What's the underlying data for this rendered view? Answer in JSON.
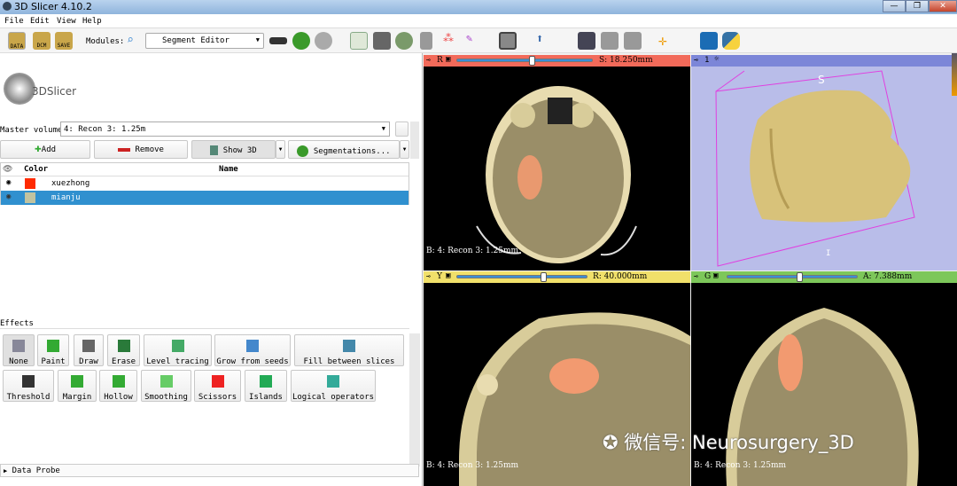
{
  "window": {
    "title": "3D Slicer 4.10.2",
    "controls": [
      "—",
      "❐",
      "✕"
    ]
  },
  "menu": [
    "File",
    "Edit",
    "View",
    "Help"
  ],
  "toolbar": {
    "data": "DATA",
    "dcm": "DCM",
    "save": "SAVE",
    "modules_label": "Modules:",
    "module_selected": "Segment Editor"
  },
  "logo": "3DSlicer",
  "editor": {
    "master_volume_label": "Master volume:",
    "master_volume": "4: Recon 3: 1.25m",
    "add": "Add",
    "remove": "Remove",
    "show3d": "Show 3D",
    "segmentations": "Segmentations...",
    "table": {
      "headers": [
        "",
        "Color",
        "Name"
      ],
      "rows": [
        {
          "name": "xuezhong",
          "color": "#ff2a00",
          "selected": false
        },
        {
          "name": "mianju",
          "color": "#c2c3a0",
          "selected": true
        }
      ]
    },
    "effects_label": "Effects",
    "effects_row1": [
      "None",
      "Paint",
      "Draw",
      "Erase",
      "Level tracing",
      "Grow from seeds",
      "Fill between slices"
    ],
    "effects_row2": [
      "Threshold",
      "Margin",
      "Hollow",
      "Smoothing",
      "Scissors",
      "Islands",
      "Logical operators"
    ],
    "data_probe": "Data Probe"
  },
  "views": {
    "red": {
      "letter": "R",
      "offset": "S: 18.250mm",
      "slider": 0.55,
      "volume": "B: 4: Recon 3: 1.25mm",
      "color": "#f26a5a"
    },
    "threeD": {
      "label": "1",
      "orientation": "S",
      "bottom": "I",
      "color": "#7c86d8"
    },
    "yellow": {
      "letter": "Y",
      "offset": "R: 40.000mm",
      "slider": 0.66,
      "volume": "B: 4: Recon 3: 1.25mm",
      "color": "#f1e06a"
    },
    "green": {
      "letter": "G",
      "offset": "A: 7.388mm",
      "slider": 0.46,
      "volume": "B: 4: Recon 3: 1.25mm",
      "color": "#7dc75a"
    }
  },
  "watermark": "微信号: Neurosurgery_3D"
}
